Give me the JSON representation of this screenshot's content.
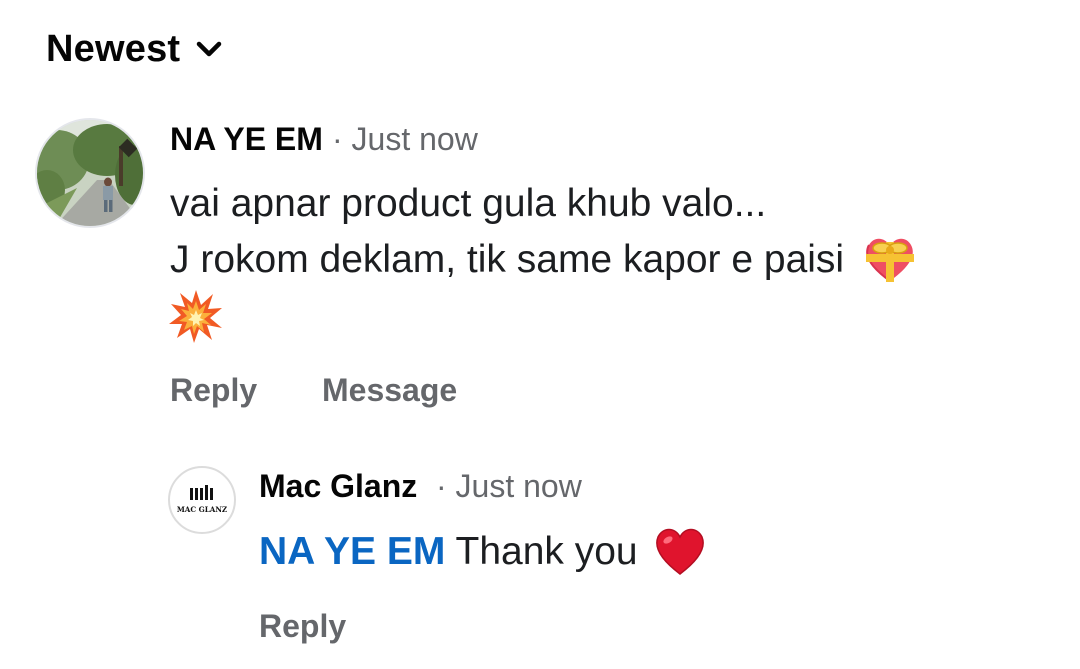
{
  "sort": {
    "label": "Newest"
  },
  "comment": {
    "author": "NA YE EM",
    "time": "· Just now",
    "line1": "vai apnar product gula khub valo...",
    "line2": "J rokom deklam, tik same kapor e paisi",
    "actions": {
      "reply": "Reply",
      "message": "Message"
    }
  },
  "reply": {
    "author": "Mac Glanz",
    "time": "· Just now",
    "avatar_text": "MAC GLANZ",
    "mention": "NA YE EM",
    "text": "Thank you",
    "actions": {
      "reply": "Reply"
    }
  },
  "icons": {
    "sort_toggle": "chevron-down-icon",
    "gift_heart": "gift-heart-emoji",
    "collision": "collision-emoji",
    "red_heart": "red-heart-emoji"
  },
  "colors": {
    "mention": "#0a66c2",
    "secondary_text": "#65676b",
    "heart": "#e0142d"
  }
}
